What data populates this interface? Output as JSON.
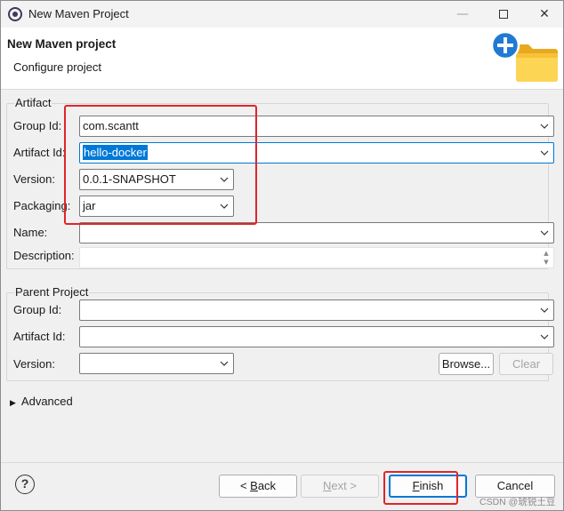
{
  "window": {
    "title": "New Maven Project",
    "minimize": "—",
    "close": "✕"
  },
  "header": {
    "title": "New Maven project",
    "subtitle": "Configure project"
  },
  "artifact": {
    "legend": "Artifact",
    "group_id": {
      "label": "Group Id:",
      "value": "com.scantt"
    },
    "artifact_id": {
      "label": "Artifact Id:",
      "value": "hello-docker"
    },
    "version": {
      "label": "Version:",
      "value": "0.0.1-SNAPSHOT"
    },
    "packaging": {
      "label": "Packaging:",
      "value": "jar"
    },
    "name": {
      "label": "Name:",
      "value": ""
    },
    "description": {
      "label": "Description:",
      "value": ""
    }
  },
  "parent": {
    "legend": "Parent Project",
    "group_id": {
      "label": "Group Id:",
      "value": ""
    },
    "artifact_id": {
      "label": "Artifact Id:",
      "value": ""
    },
    "version": {
      "label": "Version:",
      "value": ""
    },
    "browse": "Browse...",
    "clear": "Clear"
  },
  "advanced": {
    "label": "Advanced"
  },
  "footer": {
    "help": "?",
    "back_prefix": "< ",
    "back_underlined": "B",
    "back_rest": "ack",
    "next_underlined": "N",
    "next_rest": "ext >",
    "finish_underlined": "F",
    "finish_rest": "inish",
    "cancel": "Cancel"
  },
  "watermark": "CSDN @琥锐土豆",
  "colors": {
    "highlight": "#e0252a",
    "selection": "#0078d7",
    "accent": "#0078d4"
  }
}
